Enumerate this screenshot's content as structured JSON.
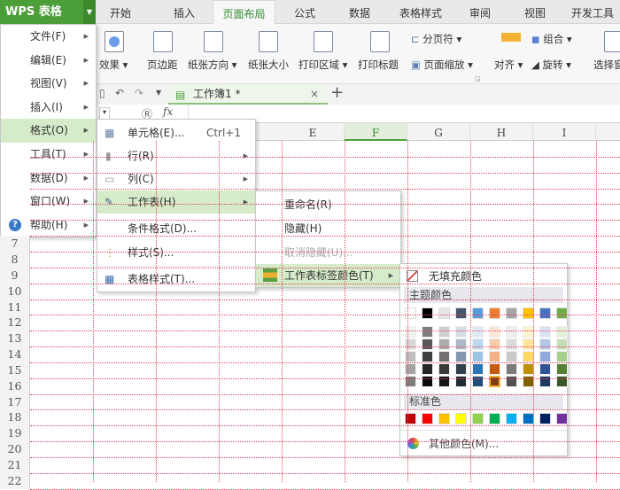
{
  "app": {
    "title": "WPS 表格"
  },
  "tabs": [
    "开始",
    "插入",
    "页面布局",
    "公式",
    "数据",
    "表格样式",
    "审阅",
    "视图",
    "开发工具"
  ],
  "active_tab": "页面布局",
  "ribbon": {
    "effects": "效果",
    "margins": "页边距",
    "orientation": "纸张方向",
    "size": "纸张大小",
    "print_area": "打印区域",
    "print_titles": "打印标题",
    "page_break": "分页符",
    "page_zoom": "页面缩放",
    "align": "对齐",
    "group": "组合",
    "rotate": "旋转",
    "selection": "选择窗"
  },
  "workbook_tab": {
    "label": "工作簿1 *",
    "close": "×",
    "add": "+"
  },
  "formula_bar": {
    "fx": "fx"
  },
  "columns": [
    "E",
    "F",
    "G",
    "H",
    "I"
  ],
  "selected_column": "F",
  "rows": [
    "7",
    "8",
    "9",
    "10",
    "11",
    "12",
    "13",
    "14",
    "15",
    "16",
    "17",
    "18",
    "19",
    "20",
    "21",
    "22"
  ],
  "main_menu": [
    {
      "label": "文件(F)"
    },
    {
      "label": "编辑(E)"
    },
    {
      "label": "视图(V)"
    },
    {
      "label": "插入(I)"
    },
    {
      "label": "格式(O)",
      "active": true
    },
    {
      "label": "工具(T)"
    },
    {
      "label": "数据(D)"
    },
    {
      "label": "窗口(W)"
    },
    {
      "label": "帮助(H)"
    }
  ],
  "format_menu": {
    "cell": "单元格(E)...",
    "cell_shortcut": "Ctrl+1",
    "row": "行(R)",
    "column": "列(C)",
    "sheet": "工作表(H)",
    "conditional": "条件格式(D)...",
    "style": "样式(S)...",
    "table_style": "表格样式(T)..."
  },
  "sheet_menu": {
    "rename": "重命名(R)",
    "hide": "隐藏(H)",
    "unhide": "取消隐藏(U)...",
    "tab_color": "工作表标签颜色(T)"
  },
  "color_panel": {
    "no_fill": "无填充颜色",
    "theme_label": "主题颜色",
    "standard_label": "标准色",
    "more": "其他颜色(M)...",
    "theme": [
      "#ffffff",
      "#000000",
      "#e7e6e6",
      "#44546a",
      "#5b9bd5",
      "#ed7d31",
      "#a5a5a5",
      "#ffc000",
      "#4472c4",
      "#70ad47"
    ],
    "shades": [
      [
        "#f2f2f2",
        "#7f7f7f",
        "#d0cece",
        "#d6dce4",
        "#deebf6",
        "#fbe5d5",
        "#ededed",
        "#fff2cc",
        "#d9e2f3",
        "#e2efd9"
      ],
      [
        "#d8d8d8",
        "#595959",
        "#aeabab",
        "#adb9ca",
        "#bdd7ee",
        "#f7cbac",
        "#dbdbdb",
        "#fee599",
        "#b4c6e7",
        "#c5e0b3"
      ],
      [
        "#bfbfbf",
        "#3f3f3f",
        "#757070",
        "#8496b0",
        "#9dc3e6",
        "#f4b183",
        "#c9c9c9",
        "#ffd965",
        "#8eaadb",
        "#a8d08d"
      ],
      [
        "#a5a5a5",
        "#262626",
        "#3a3838",
        "#323f4f",
        "#2e75b5",
        "#c55a11",
        "#7b7b7b",
        "#bf9000",
        "#2f5496",
        "#538135"
      ],
      [
        "#7f7f7f",
        "#0c0c0c",
        "#171616",
        "#222a35",
        "#1e4e79",
        "#843c0c",
        "#525252",
        "#7f6000",
        "#1f3864",
        "#375623"
      ]
    ],
    "selected": "#843c0c",
    "standard": [
      "#c00000",
      "#ff0000",
      "#ffc000",
      "#ffff00",
      "#92d050",
      "#00b050",
      "#00b0f0",
      "#0070c0",
      "#002060",
      "#7030a0"
    ]
  }
}
